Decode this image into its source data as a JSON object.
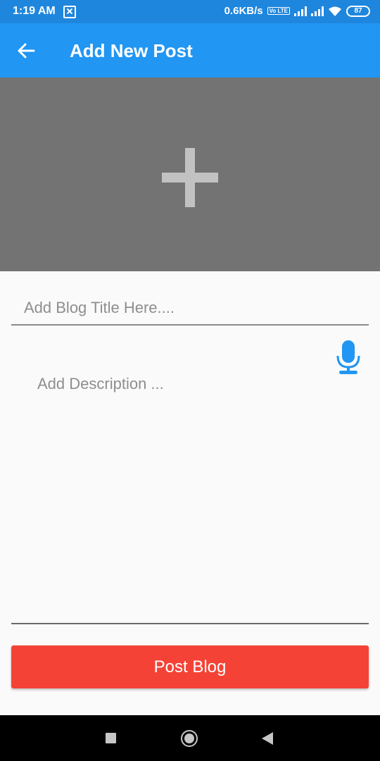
{
  "status_bar": {
    "time": "1:19 AM",
    "network_speed": "0.6KB/s",
    "volte_label": "Vo LTE",
    "battery_level": "87",
    "icons": [
      "notification-icon",
      "signal-icon",
      "signal-icon",
      "wifi-icon",
      "battery-icon"
    ]
  },
  "app_bar": {
    "title": "Add New Post",
    "back_icon": "arrow-back-icon"
  },
  "image_picker": {
    "icon": "plus-icon"
  },
  "form": {
    "title_placeholder": "Add Blog Title Here....",
    "description_placeholder": "Add Description ...",
    "mic_icon": "microphone-icon",
    "submit_label": "Post Blog"
  },
  "colors": {
    "status_bar": "#1f86dd",
    "app_bar": "#2196f3",
    "image_picker_bg": "#737373",
    "accent": "#2196f3",
    "submit_button": "#f44336"
  },
  "nav_bar": {
    "buttons": [
      "recent-apps-icon",
      "home-icon",
      "back-icon"
    ]
  }
}
